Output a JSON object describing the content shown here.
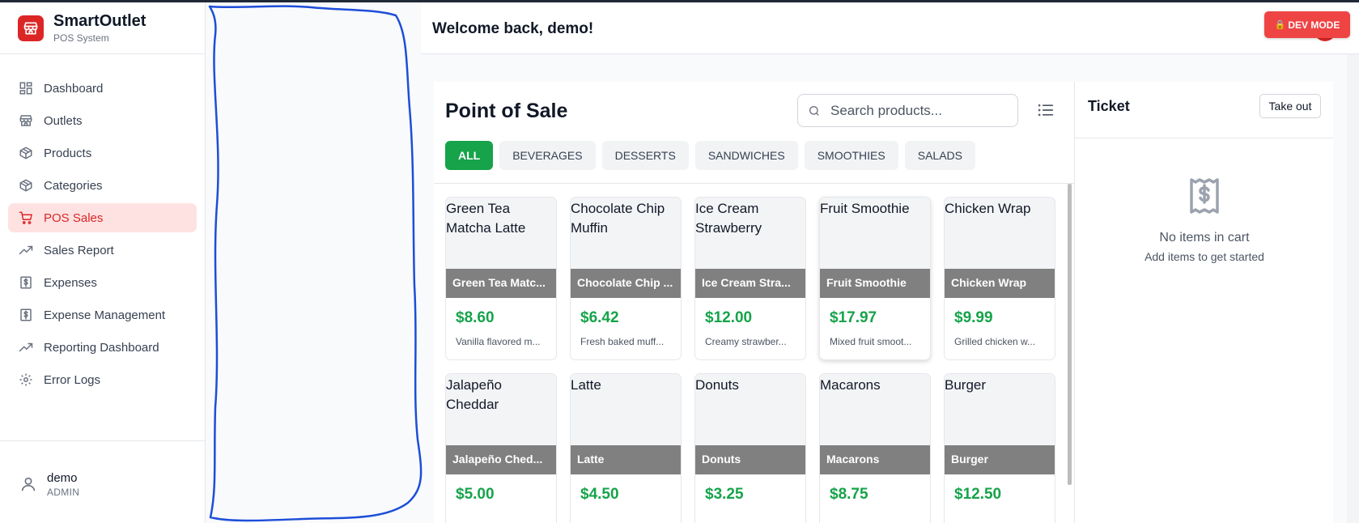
{
  "brand": {
    "title": "SmartOutlet",
    "subtitle": "POS System"
  },
  "sidebar": {
    "items": [
      {
        "label": "Dashboard",
        "icon": "dashboard-icon"
      },
      {
        "label": "Outlets",
        "icon": "store-icon"
      },
      {
        "label": "Products",
        "icon": "box-icon"
      },
      {
        "label": "Categories",
        "icon": "box-icon"
      },
      {
        "label": "POS Sales",
        "icon": "cart-icon",
        "active": true
      },
      {
        "label": "Sales Report",
        "icon": "trending-up-icon"
      },
      {
        "label": "Expenses",
        "icon": "dollar-receipt-icon"
      },
      {
        "label": "Expense Management",
        "icon": "dollar-receipt-icon"
      },
      {
        "label": "Reporting Dashboard",
        "icon": "trending-up-icon"
      },
      {
        "label": "Error Logs",
        "icon": "gear-icon"
      }
    ]
  },
  "user": {
    "name": "demo",
    "role": "ADMIN"
  },
  "header": {
    "welcome": "Welcome back, demo!",
    "dev_mode": "DEV MODE"
  },
  "pos": {
    "title": "Point of Sale",
    "search_placeholder": "Search products...",
    "categories": [
      "ALL",
      "BEVERAGES",
      "DESSERTS",
      "SANDWICHES",
      "SMOOTHIES",
      "SALADS"
    ],
    "products": [
      {
        "alt": "Green Tea Matcha Latte",
        "name": "Green Tea Matc...",
        "price": "$8.60",
        "desc": "Vanilla flavored m..."
      },
      {
        "alt": "Chocolate Chip Muffin",
        "name": "Chocolate Chip ...",
        "price": "$6.42",
        "desc": "Fresh baked muff..."
      },
      {
        "alt": "Ice Cream Strawberry",
        "name": "Ice Cream Stra...",
        "price": "$12.00",
        "desc": "Creamy strawber..."
      },
      {
        "alt": "Fruit Smoothie",
        "name": "Fruit Smoothie",
        "price": "$17.97",
        "desc": "Mixed fruit smoot..."
      },
      {
        "alt": "Chicken Wrap",
        "name": "Chicken Wrap",
        "price": "$9.99",
        "desc": "Grilled chicken w..."
      },
      {
        "alt": "Jalapeño Cheddar",
        "name": "Jalapeño Ched...",
        "price": "$5.00",
        "desc": ""
      },
      {
        "alt": "Latte",
        "name": "Latte",
        "price": "$4.50",
        "desc": ""
      },
      {
        "alt": "Donuts",
        "name": "Donuts",
        "price": "$3.25",
        "desc": ""
      },
      {
        "alt": "Macarons",
        "name": "Macarons",
        "price": "$8.75",
        "desc": ""
      },
      {
        "alt": "Burger",
        "name": "Burger",
        "price": "$12.50",
        "desc": ""
      }
    ]
  },
  "ticket": {
    "title": "Ticket",
    "takeout_label": "Take out",
    "empty_title": "No items in cart",
    "empty_sub": "Add items to get started"
  },
  "colors": {
    "brand": "#dc2626",
    "accent_green": "#16a34a",
    "dev_mode": "#ef4444"
  }
}
